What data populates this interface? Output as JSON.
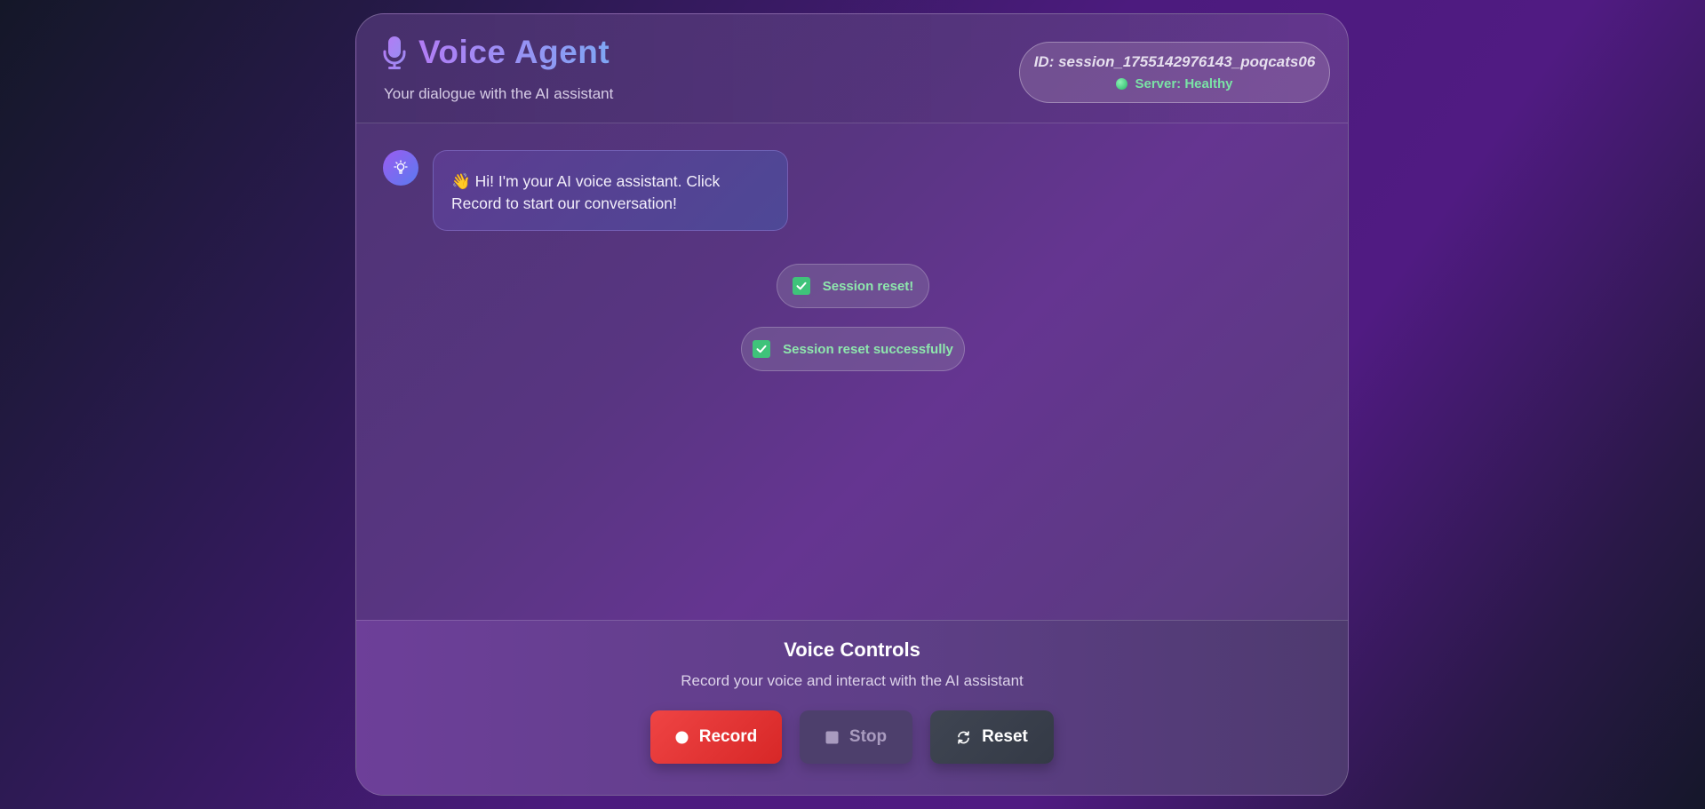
{
  "header": {
    "title": "Voice Agent",
    "subtitle": "Your dialogue with the AI assistant",
    "session_id": "ID: session_1755142976143_poqcats06",
    "server_status": "Server: Healthy"
  },
  "chat": {
    "messages": [
      {
        "role": "assistant",
        "text": "👋 Hi! I'm your AI voice assistant. Click Record to start our conversation!"
      }
    ],
    "notifications": [
      {
        "text": "Session reset!"
      },
      {
        "text": "Session reset successfully"
      }
    ]
  },
  "controls": {
    "title": "Voice Controls",
    "subtitle": "Record your voice and interact with the AI assistant",
    "record_label": "Record",
    "stop_label": "Stop",
    "reset_label": "Reset"
  },
  "icons": {
    "title": "microphone-icon",
    "avatar": "lightbulb-icon",
    "status": "status-dot-icon",
    "notification": "checkbox-icon",
    "record": "record-dot-icon",
    "stop": "stop-square-icon",
    "reset": "refresh-icon"
  },
  "colors": {
    "accent_purple": "#b27cf5",
    "accent_blue": "#7fa6f4",
    "status_green": "#3fc37a",
    "record_red": "#ef4444"
  }
}
